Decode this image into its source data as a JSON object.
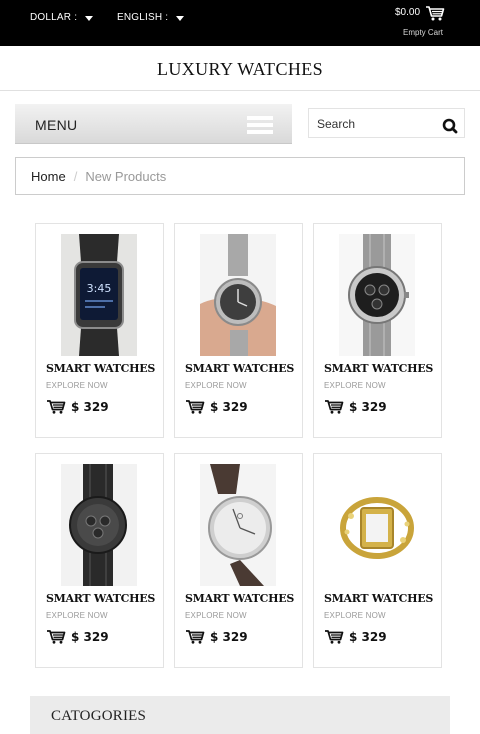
{
  "header": {
    "currency_label": "DOLLAR :",
    "language_label": "ENGLISH :",
    "cart_amount": "$0.00",
    "cart_status": "Empty Cart"
  },
  "site": {
    "title": "LUXURY WATCHES"
  },
  "menu": {
    "label": "MENU"
  },
  "search": {
    "placeholder": "Search"
  },
  "breadcrumb": {
    "home": "Home",
    "separator": "/",
    "current": "New Products"
  },
  "products": [
    {
      "name": "SMART WATCHES",
      "link": "EXPLORE NOW",
      "price": "$ 329",
      "image": "smartwatch-black"
    },
    {
      "name": "SMART WATCHES",
      "link": "EXPLORE NOW",
      "price": "$ 329",
      "image": "watch-on-wrist"
    },
    {
      "name": "SMART WATCHES",
      "link": "EXPLORE NOW",
      "price": "$ 329",
      "image": "steel-chronograph"
    },
    {
      "name": "SMART WATCHES",
      "link": "EXPLORE NOW",
      "price": "$ 329",
      "image": "black-steel-chronograph"
    },
    {
      "name": "SMART WATCHES",
      "link": "EXPLORE NOW",
      "price": "$ 329",
      "image": "white-dial-leather"
    },
    {
      "name": "SMART WATCHES",
      "link": "EXPLORE NOW",
      "price": "$ 329",
      "image": "gold-jeweled-bangle"
    }
  ],
  "categories": {
    "title": "CATOGORIES"
  },
  "colors": {
    "topbar": "#000000",
    "menu_gradient_top": "#f2f2f2",
    "menu_gradient_bottom": "#d9d9d9",
    "categories_bg": "#ebebeb"
  }
}
